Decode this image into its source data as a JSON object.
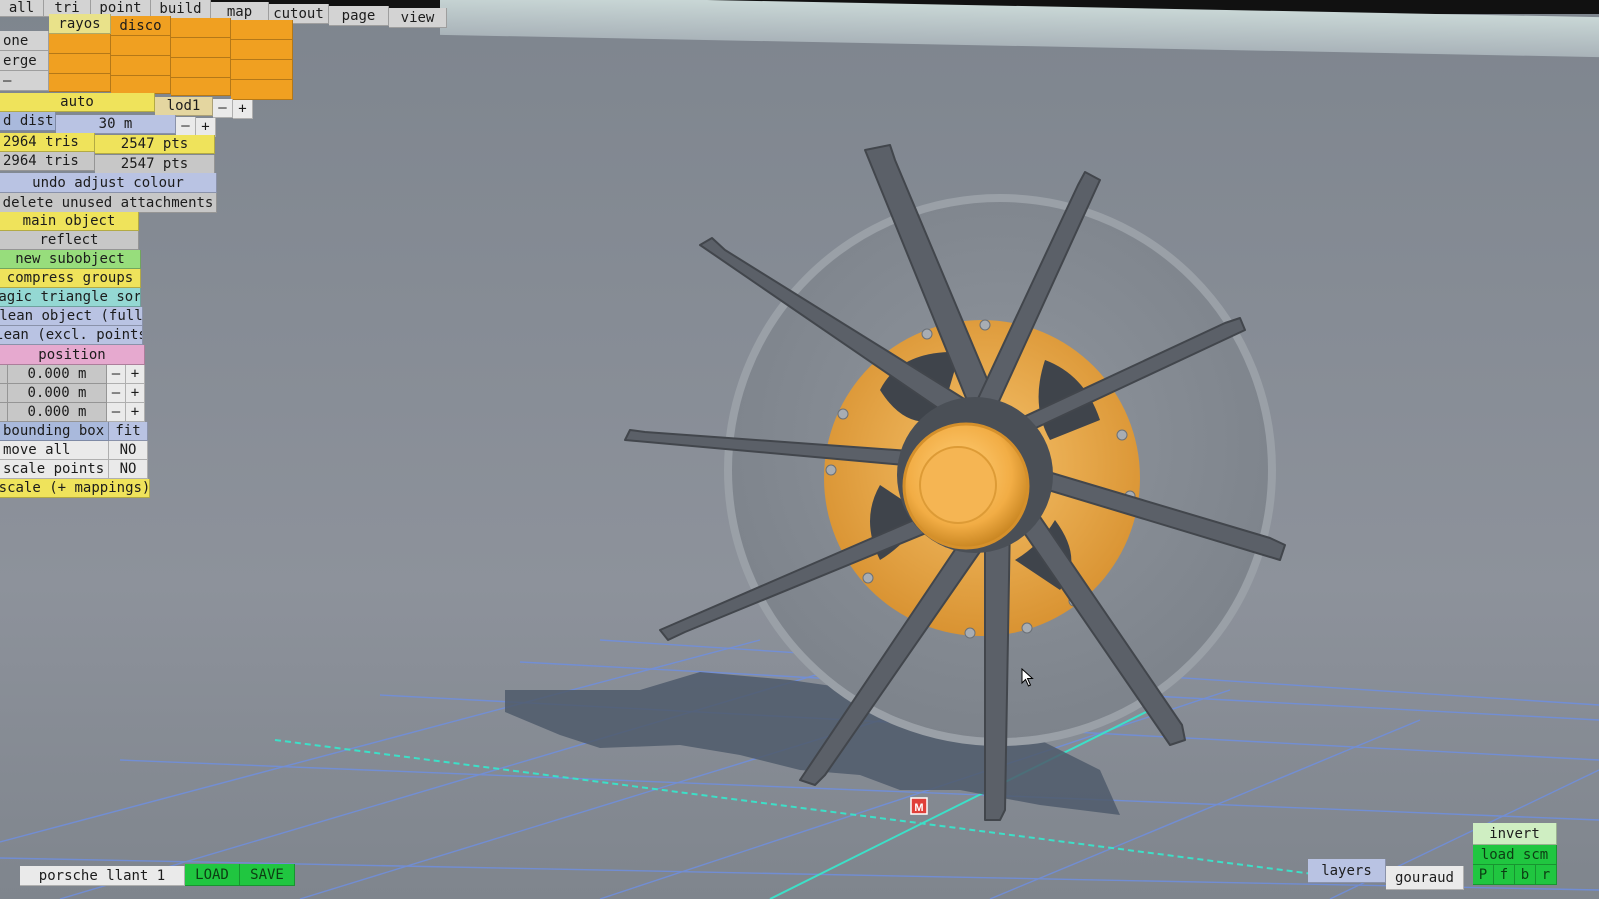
{
  "menu": {
    "all_label": "all",
    "tri_label": "tri",
    "point_label": "point",
    "build_label": "build",
    "map_label": "map",
    "cutout_label": "cutout",
    "page_label": "page",
    "view_label": "view"
  },
  "materials": {
    "row_labels": [
      "one",
      "erge",
      "–"
    ],
    "tab_rayos": "rayos",
    "tab_disco": "disco"
  },
  "lod": {
    "auto_label": "auto",
    "lod_value": "lod1",
    "minus": "–",
    "plus": "+"
  },
  "dist": {
    "label": "d dist",
    "value": "30 m",
    "minus": "–",
    "plus": "+"
  },
  "stats": {
    "row1_tris": "2964 tris",
    "row1_pts": "2547 pts",
    "row2_tris": "2964 tris",
    "row2_pts": "2547 pts"
  },
  "actions": {
    "undo_adjust_colour": "undo adjust colour",
    "delete_unused_attachments": "delete unused attachments",
    "main_object": "main object",
    "reflect": "reflect",
    "new_subobject": "new subobject",
    "compress_groups": "compress groups",
    "magic_triangle_sort": "magic triangle sort",
    "clean_object_full": "clean object (full)",
    "clean_excl_points": "clean (excl. points)",
    "position": "position"
  },
  "position": {
    "x_value": "0.000 m",
    "y_value": "0.000 m",
    "z_value": "0.000 m",
    "minus": "–",
    "plus": "+"
  },
  "bounding": {
    "label": "bounding box",
    "fit": "fit",
    "move_all": "move all",
    "move_all_value": "NO",
    "scale_points": "scale points",
    "scale_points_value": "NO",
    "scale_mappings": "scale (+ mappings)"
  },
  "bottom": {
    "filename": "porsche llant 1",
    "load": "LOAD",
    "save": "SAVE",
    "layers": "layers",
    "shading": "gouraud",
    "invert": "invert",
    "load_scm": "load scm",
    "flags": [
      "P",
      "f",
      "b",
      "r"
    ]
  },
  "viewport": {
    "marker_label": "M"
  },
  "colors": {
    "accent_orange": "#f0a021",
    "spoke_grey": "#5b6068",
    "hub_gold": "#f2b04a",
    "grid_blue": "#6f8fe0",
    "grid_axis_cyan": "#3ce0c8"
  }
}
